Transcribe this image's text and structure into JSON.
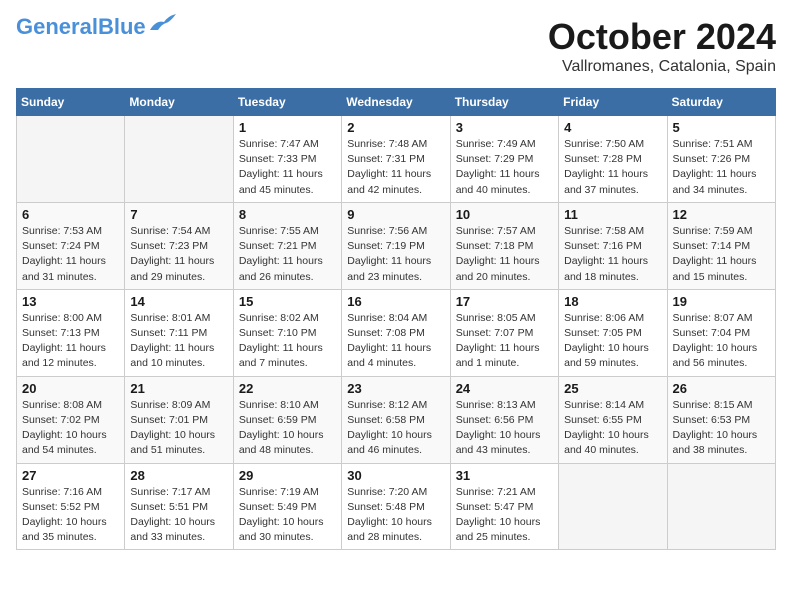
{
  "logo": {
    "general": "General",
    "blue": "Blue"
  },
  "title": "October 2024",
  "subtitle": "Vallromanes, Catalonia, Spain",
  "weekdays": [
    "Sunday",
    "Monday",
    "Tuesday",
    "Wednesday",
    "Thursday",
    "Friday",
    "Saturday"
  ],
  "weeks": [
    [
      {
        "day": "",
        "info": ""
      },
      {
        "day": "",
        "info": ""
      },
      {
        "day": "1",
        "info": "Sunrise: 7:47 AM\nSunset: 7:33 PM\nDaylight: 11 hours and 45 minutes."
      },
      {
        "day": "2",
        "info": "Sunrise: 7:48 AM\nSunset: 7:31 PM\nDaylight: 11 hours and 42 minutes."
      },
      {
        "day": "3",
        "info": "Sunrise: 7:49 AM\nSunset: 7:29 PM\nDaylight: 11 hours and 40 minutes."
      },
      {
        "day": "4",
        "info": "Sunrise: 7:50 AM\nSunset: 7:28 PM\nDaylight: 11 hours and 37 minutes."
      },
      {
        "day": "5",
        "info": "Sunrise: 7:51 AM\nSunset: 7:26 PM\nDaylight: 11 hours and 34 minutes."
      }
    ],
    [
      {
        "day": "6",
        "info": "Sunrise: 7:53 AM\nSunset: 7:24 PM\nDaylight: 11 hours and 31 minutes."
      },
      {
        "day": "7",
        "info": "Sunrise: 7:54 AM\nSunset: 7:23 PM\nDaylight: 11 hours and 29 minutes."
      },
      {
        "day": "8",
        "info": "Sunrise: 7:55 AM\nSunset: 7:21 PM\nDaylight: 11 hours and 26 minutes."
      },
      {
        "day": "9",
        "info": "Sunrise: 7:56 AM\nSunset: 7:19 PM\nDaylight: 11 hours and 23 minutes."
      },
      {
        "day": "10",
        "info": "Sunrise: 7:57 AM\nSunset: 7:18 PM\nDaylight: 11 hours and 20 minutes."
      },
      {
        "day": "11",
        "info": "Sunrise: 7:58 AM\nSunset: 7:16 PM\nDaylight: 11 hours and 18 minutes."
      },
      {
        "day": "12",
        "info": "Sunrise: 7:59 AM\nSunset: 7:14 PM\nDaylight: 11 hours and 15 minutes."
      }
    ],
    [
      {
        "day": "13",
        "info": "Sunrise: 8:00 AM\nSunset: 7:13 PM\nDaylight: 11 hours and 12 minutes."
      },
      {
        "day": "14",
        "info": "Sunrise: 8:01 AM\nSunset: 7:11 PM\nDaylight: 11 hours and 10 minutes."
      },
      {
        "day": "15",
        "info": "Sunrise: 8:02 AM\nSunset: 7:10 PM\nDaylight: 11 hours and 7 minutes."
      },
      {
        "day": "16",
        "info": "Sunrise: 8:04 AM\nSunset: 7:08 PM\nDaylight: 11 hours and 4 minutes."
      },
      {
        "day": "17",
        "info": "Sunrise: 8:05 AM\nSunset: 7:07 PM\nDaylight: 11 hours and 1 minute."
      },
      {
        "day": "18",
        "info": "Sunrise: 8:06 AM\nSunset: 7:05 PM\nDaylight: 10 hours and 59 minutes."
      },
      {
        "day": "19",
        "info": "Sunrise: 8:07 AM\nSunset: 7:04 PM\nDaylight: 10 hours and 56 minutes."
      }
    ],
    [
      {
        "day": "20",
        "info": "Sunrise: 8:08 AM\nSunset: 7:02 PM\nDaylight: 10 hours and 54 minutes."
      },
      {
        "day": "21",
        "info": "Sunrise: 8:09 AM\nSunset: 7:01 PM\nDaylight: 10 hours and 51 minutes."
      },
      {
        "day": "22",
        "info": "Sunrise: 8:10 AM\nSunset: 6:59 PM\nDaylight: 10 hours and 48 minutes."
      },
      {
        "day": "23",
        "info": "Sunrise: 8:12 AM\nSunset: 6:58 PM\nDaylight: 10 hours and 46 minutes."
      },
      {
        "day": "24",
        "info": "Sunrise: 8:13 AM\nSunset: 6:56 PM\nDaylight: 10 hours and 43 minutes."
      },
      {
        "day": "25",
        "info": "Sunrise: 8:14 AM\nSunset: 6:55 PM\nDaylight: 10 hours and 40 minutes."
      },
      {
        "day": "26",
        "info": "Sunrise: 8:15 AM\nSunset: 6:53 PM\nDaylight: 10 hours and 38 minutes."
      }
    ],
    [
      {
        "day": "27",
        "info": "Sunrise: 7:16 AM\nSunset: 5:52 PM\nDaylight: 10 hours and 35 minutes."
      },
      {
        "day": "28",
        "info": "Sunrise: 7:17 AM\nSunset: 5:51 PM\nDaylight: 10 hours and 33 minutes."
      },
      {
        "day": "29",
        "info": "Sunrise: 7:19 AM\nSunset: 5:49 PM\nDaylight: 10 hours and 30 minutes."
      },
      {
        "day": "30",
        "info": "Sunrise: 7:20 AM\nSunset: 5:48 PM\nDaylight: 10 hours and 28 minutes."
      },
      {
        "day": "31",
        "info": "Sunrise: 7:21 AM\nSunset: 5:47 PM\nDaylight: 10 hours and 25 minutes."
      },
      {
        "day": "",
        "info": ""
      },
      {
        "day": "",
        "info": ""
      }
    ]
  ]
}
